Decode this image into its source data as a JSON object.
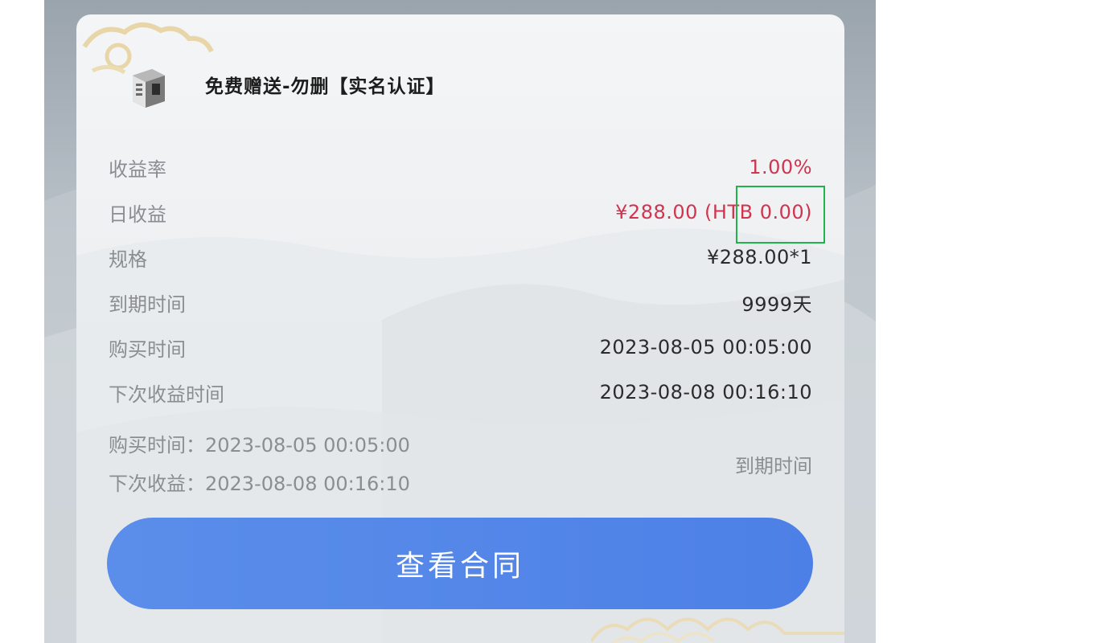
{
  "product": {
    "title": "免费赠送-勿删【实名认证】",
    "icon": "server-box-icon"
  },
  "details": [
    {
      "label": "收益率",
      "value": "1.00%",
      "accent": "red"
    },
    {
      "label": "日收益",
      "value": "¥288.00 (HTB 0.00)",
      "accent": "red"
    },
    {
      "label": "规格",
      "value": "¥288.00*1",
      "accent": "dark"
    },
    {
      "label": "到期时间",
      "value": "9999天",
      "accent": "dark"
    },
    {
      "label": "购买时间",
      "value": "2023-08-05 00:05:00",
      "accent": "dark"
    },
    {
      "label": "下次收益时间",
      "value": "2023-08-08 00:16:10",
      "accent": "dark"
    }
  ],
  "summary": {
    "purchase_line": "购买时间：2023-08-05 00:05:00",
    "next_line": "下次收益：2023-08-08 00:16:10",
    "expiry_label": "到期时间"
  },
  "actions": {
    "view_contract": "查看合同"
  },
  "colors": {
    "accent_red": "#d0344f",
    "button_blue": "#5283e8",
    "highlight_green": "#22b24c"
  }
}
